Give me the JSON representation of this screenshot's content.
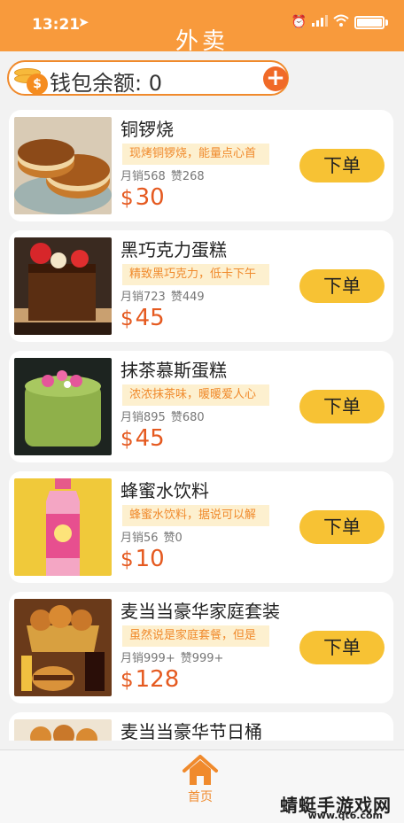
{
  "status_bar": {
    "time": "13:21"
  },
  "header": {
    "title": "外卖"
  },
  "wallet": {
    "label": "钱包余额: 0",
    "add_label": "+"
  },
  "products": [
    {
      "name": "铜锣烧",
      "tag": "现烤铜锣烧，能量点心首",
      "sales": "月销568",
      "likes": "赞268",
      "currency": "$",
      "price": "30",
      "button": "下单"
    },
    {
      "name": "黑巧克力蛋糕",
      "tag": "精致黑巧克力，低卡下午",
      "sales": "月销723",
      "likes": "赞449",
      "currency": "$",
      "price": "45",
      "button": "下单"
    },
    {
      "name": "抹茶慕斯蛋糕",
      "tag": "浓浓抹茶味，暖暖爱人心",
      "sales": "月销895",
      "likes": "赞680",
      "currency": "$",
      "price": "45",
      "button": "下单"
    },
    {
      "name": "蜂蜜水饮料",
      "tag": "蜂蜜水饮料，据说可以解",
      "sales": "月销56",
      "likes": "赞0",
      "currency": "$",
      "price": "10",
      "button": "下单"
    },
    {
      "name": "麦当当豪华家庭套装",
      "tag": "虽然说是家庭套餐，但是",
      "sales": "月销999+",
      "likes": "赞999+",
      "currency": "$",
      "price": "128",
      "button": "下单"
    },
    {
      "name": "麦当当豪华节日桶"
    }
  ],
  "tabbar": {
    "home_label": "首页"
  },
  "watermark": {
    "text": "蜻蜓手游戏网",
    "url": "www.qt6.com"
  },
  "colors": {
    "header": "#f89a3c",
    "order_button": "#f7c234",
    "price": "#e55a20",
    "tag_bg": "#fdf0cf"
  }
}
